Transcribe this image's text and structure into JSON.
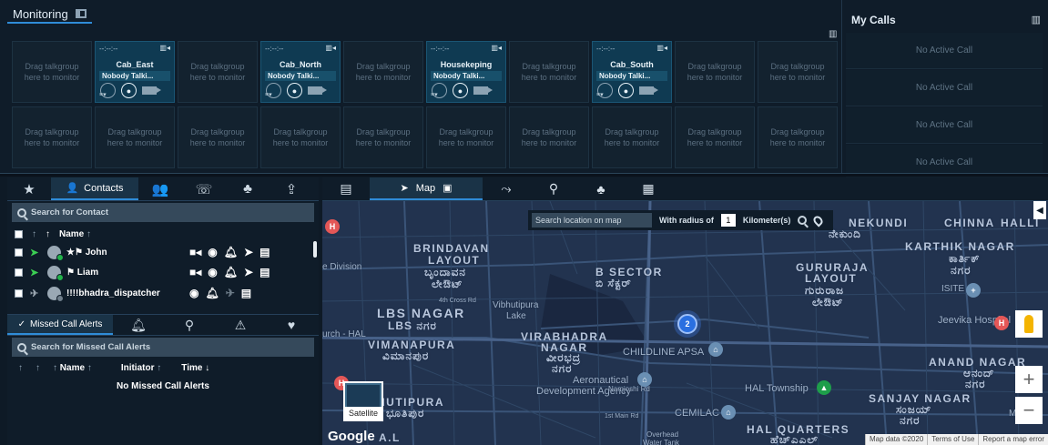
{
  "monitoring": {
    "tab_label": "Monitoring",
    "empty_tile_text": "Drag talkgroup here to monitor",
    "active_tiles": [
      {
        "time": "--:--:--",
        "name": "Cab_East",
        "status": "Nobody Talki..."
      },
      {
        "time": "--:--:--",
        "name": "Cab_North",
        "status": "Nobody Talki..."
      },
      {
        "time": "--:--:--",
        "name": "Housekeping",
        "status": "Nobody Talki..."
      },
      {
        "time": "--:--:--",
        "name": "Cab_South",
        "status": "Nobody Talki..."
      }
    ]
  },
  "my_calls": {
    "title": "My Calls",
    "slots": [
      "No Active Call",
      "No Active Call",
      "No Active Call",
      "No Active Call"
    ]
  },
  "contacts": {
    "tab_label": "Contacts",
    "search_placeholder": "Search for Contact",
    "header_name": "Name",
    "rows": [
      {
        "name": "★⚑ John",
        "online": true
      },
      {
        "name": "⚑ Liam",
        "online": true
      },
      {
        "name": "!!!!bhadra_dispatcher",
        "online": false
      }
    ]
  },
  "alerts": {
    "tab_label": "Missed Call Alerts",
    "search_placeholder": "Search for Missed Call Alerts",
    "col_name": "Name",
    "col_initiator": "Initiator",
    "col_time": "Time",
    "empty_text": "No Missed Call Alerts"
  },
  "map": {
    "tab_label": "Map",
    "search_placeholder": "Search location on map",
    "radius_label": "With radius of",
    "radius_value": "1",
    "radius_unit": "Kilometer(s)",
    "cluster_count": "2",
    "satellite_label": "Satellite",
    "google_label": "Google",
    "attribution": [
      "Map data ©2020",
      "Terms of Use",
      "Report a map error"
    ],
    "labels": {
      "brindavan": "BRINDAVAN",
      "layout": "LAYOUT",
      "brindavan_kn": "ಬೃಂದಾವನ",
      "layout_kn": "ಲೇಔಟ್",
      "bsector": "B SECTOR",
      "bsector_kn": "ಬಿ ಸೆಕ್ಟರ್",
      "gururaja": "GURURAJA",
      "gururaja_layout": "LAYOUT",
      "gururaja_kn": "ಗುರುರಾಜ",
      "gururaja_layout_kn": "ಲೇಔಟ್",
      "nekundi": "NEKUNDI",
      "nekundi_kn": "ನೇಕುಂದಿ",
      "chinna": "CHINNA",
      "halli": "HALLI",
      "karthik": "KARTHIK NAGAR",
      "karthik_kn": "ಕಾರ್ತಿಕ್",
      "nagar_kn": "ನಗರ",
      "lbs": "LBS NAGAR",
      "lbs_kn": "LBS ನಗರ",
      "vibhutipura_lake": "Vibhutipura",
      "lake": "Lake",
      "e_division": "e Division",
      "cross4": "4th Cross Rd",
      "urch_hal": "urch - HAL",
      "vimanapura": "VIMANAPURA",
      "vimanapura_kn": "ವಿಮಾನಪುರ",
      "virabhadra": "VIRABHADRA",
      "virabhadra_nagar": "NAGAR",
      "virabhadra_kn": "ವೀರಭದ್ರ",
      "virabhadra_nagar_kn": "ನಗರ",
      "childline": "CHILDLINE APSA",
      "aeronautical": "Aeronautical",
      "dev_engg": "Development Agency",
      "hal_township": "HAL Township",
      "cemilac": "CEMILAC",
      "hutipura": "HUTIPURA",
      "hutipura_kn": "ಭೂತಿಪುರ",
      "hal_quarters": "HAL QUARTERS",
      "hal_quarters_kn": "ಹೆಚ್ಎಎಲ್",
      "anand": "ANAND NAGAR",
      "anand_kn": "ಆನಂದ್",
      "anand_nagar_kn": "ನಗರ",
      "sanjay": "SANJAY NAGAR",
      "sanjay_kn": "ಸಂಜಯ್",
      "sanjay_nagar_kn": "ನಗರ",
      "jeevika": "Jeevika Hospital",
      "isite": "ISITE",
      "main_rd": "1st Main Rd",
      "ala": "A.L",
      "munn": "Munn",
      "overhead": "Overhead",
      "water_tank": "Water Tank",
      "namjoshi": "Namjoshi Rd"
    }
  }
}
